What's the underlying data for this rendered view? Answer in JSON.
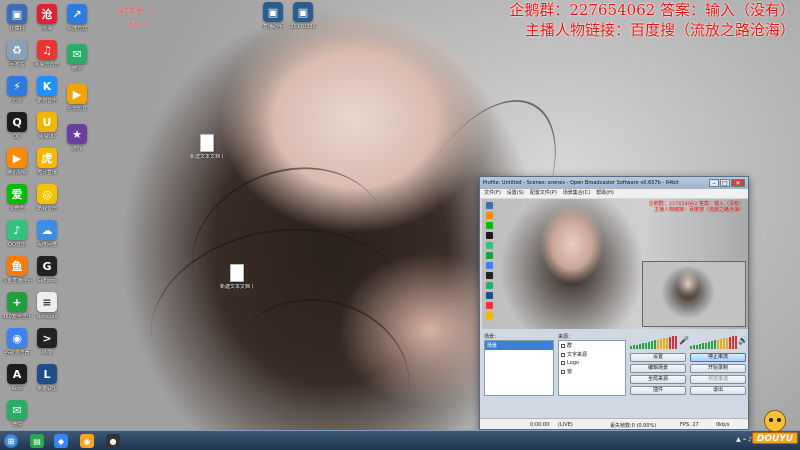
{
  "banner": {
    "line1": "企鹅群：227654062 答案：输入（没有）",
    "line2": "主播人物链接：百度搜（流放之路沧海）"
  },
  "top_overlay": {
    "label1": "缓存数据：0",
    "label2": "系统：0"
  },
  "desktop_icons": [
    {
      "label": "计算机",
      "color": "#3a6fb5",
      "glyph": "▣"
    },
    {
      "label": "回收站",
      "color": "#8aa0b8",
      "glyph": "♻"
    },
    {
      "label": "迅雷",
      "color": "#2d7be0",
      "glyph": "⚡"
    },
    {
      "label": "QQ",
      "color": "#1b1b1b",
      "glyph": "Q"
    },
    {
      "label": "腾讯视频",
      "color": "#ff8a00",
      "glyph": "▶"
    },
    {
      "label": "爱奇艺",
      "color": "#00be06",
      "glyph": "爱"
    },
    {
      "label": "QQ音乐",
      "color": "#31c27c",
      "glyph": "♪"
    },
    {
      "label": "斗鱼直播伴侣",
      "color": "#ff7a00",
      "glyph": "鱼"
    },
    {
      "label": "360安全卫士",
      "color": "#1fa03c",
      "glyph": "+"
    },
    {
      "label": "谷歌浏览器",
      "color": "#3b82f6",
      "glyph": "◉"
    },
    {
      "label": "Aion",
      "color": "#1d1d1d",
      "glyph": "A"
    },
    {
      "label": "微信",
      "color": "#2aae67",
      "glyph": "✉"
    }
  ],
  "desktop_icons_col2": [
    {
      "label": "沧海",
      "color": "#d23",
      "glyph": "沧"
    },
    {
      "label": "网易云音乐",
      "color": "#e33",
      "glyph": "♫"
    },
    {
      "label": "酷狗音乐",
      "color": "#1e90ff",
      "glyph": "K"
    },
    {
      "label": "网易UU",
      "color": "#f2b500",
      "glyph": "U"
    },
    {
      "label": "虎牙直播",
      "color": "#ffb400",
      "glyph": "虎"
    },
    {
      "label": "酷我音乐",
      "color": "#f5c400",
      "glyph": "◎"
    },
    {
      "label": "百度网盘",
      "color": "#3a8ee6",
      "glyph": "☁"
    },
    {
      "label": "GeForce",
      "color": "#222",
      "glyph": "G"
    },
    {
      "label": "Notepad",
      "color": "#eee",
      "glyph": "≡"
    },
    {
      "label": "终端",
      "color": "#222",
      "glyph": ">"
    },
    {
      "label": "英雄联盟",
      "color": "#1d4e89",
      "glyph": "L"
    }
  ],
  "desktop_icons_col3": [
    {
      "label": "快捷方式",
      "color": "#2d7be0",
      "glyph": "↗"
    },
    {
      "label": "微信",
      "color": "#2aae67",
      "glyph": "✉"
    },
    {
      "label": "迅雷影音",
      "color": "#f0a500",
      "glyph": "▶"
    },
    {
      "label": "游戏",
      "color": "#6b3fa0",
      "glyph": "★"
    }
  ],
  "desktop_files": [
    {
      "label": "新建文本文档 (3)"
    },
    {
      "label": "新建文本文档 (2)"
    }
  ],
  "top_icons": [
    {
      "label": "直播助手"
    },
    {
      "label": "20170330"
    }
  ],
  "obs": {
    "title": "Profile: Untitled - Scenes: scenes - Open Broadcaster Software v0.657b - 64bit",
    "menu": [
      "文件(F)",
      "设置(S)",
      "配置文件(P)",
      "场景集合(C)",
      "帮助(H)"
    ],
    "preview_banner_1": "企鹅群：227654062 答案：输入（没有）",
    "preview_banner_2": "主播人物链接：百度搜（流放之路沧海）",
    "scenes_label": "场景：",
    "sources_label": "来源：",
    "scenes": [
      "场景"
    ],
    "sources": [
      "群",
      "文字来源",
      "Logo",
      "窗"
    ],
    "buttons": {
      "settings": "设置",
      "stop_stream": "停止串流",
      "edit_scene": "编辑场景",
      "start_recording": "开始录制",
      "global_sources": "全局来源",
      "preview_stream": "预览串流",
      "plugins": "插件",
      "exit": "退出"
    },
    "status": {
      "time": "0:00:00",
      "live": "(LIVE)",
      "dropped": "丢失帧数:0 (0.00%)",
      "fps": "FPS: 27",
      "bitrate": "0kb/s"
    }
  },
  "douyu": "DOUYU"
}
